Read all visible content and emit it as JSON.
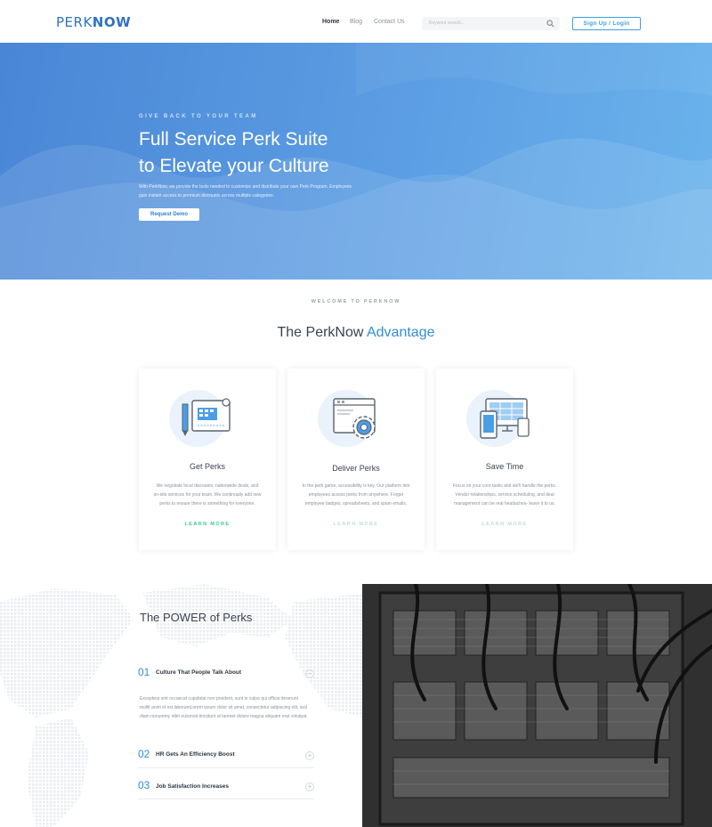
{
  "header": {
    "logo_light": "PERK",
    "logo_bold": "NOW",
    "nav": [
      "Home",
      "Blog",
      "Contact Us"
    ],
    "search_placeholder": "Keyword search...",
    "signup_label": "Sign Up / Login"
  },
  "hero": {
    "eyebrow": "GIVE BACK TO YOUR TEAM",
    "title_line1": "Full Service Perk Suite",
    "title_line2": "to Elevate your Culture",
    "description": "With PerkNow, we provide the tools needed to customize and distribute your own Perk Program. Employees gain instant access to premium discounts across multiple categories.",
    "button_label": "Request Demo"
  },
  "advantage": {
    "eyebrow": "WELCOME TO PERKNOW",
    "title_plain": "The PerkNow",
    "title_accent": "Advantage",
    "cards": [
      {
        "icon": "blueprint-icon",
        "title": "Get Perks",
        "text": "We negotiate local discounts, nationwide deals, and on-site services for your team. We continually add new perks to ensure there is something for everyone.",
        "link": "LEARN MORE",
        "link_color": "#3ec78f"
      },
      {
        "icon": "gear-window-icon",
        "title": "Deliver Perks",
        "text": "In the perk game, accessibility is key. Our platform lets employees access perks from anywhere. Forget employee badges, spreadsheets, and spam emails.",
        "link": "LEARN MORE",
        "link_color": "#b9e3d1"
      },
      {
        "icon": "devices-icon",
        "title": "Save Time",
        "text": "Focus on your core tasks and we'll handle the perks. Vendor relationships, service scheduling, and deal management can be real headaches- leave it to us.",
        "link": "LEARN MORE",
        "link_color": "#b9e3d1"
      }
    ]
  },
  "power": {
    "title": "The POWER of Perks",
    "items": [
      {
        "number": "01",
        "label": "Culture That People Talk About",
        "toggle": "−",
        "body": "Excepteur sint occaecat cupidatat non proident, sunt in culpa qui officia deserunt mollit anim id est laborumLorem ipsum dolor sit amet, consectetur adipiscing elit, sed diam nonummy nibh euismod tincidunt ut laoreet dolore magna aliquam erat volutpat."
      },
      {
        "number": "02",
        "label": "HR Gets An Efficiency Boost",
        "toggle": "+"
      },
      {
        "number": "03",
        "label": "Job Satisfaction Increases",
        "toggle": "+"
      }
    ]
  }
}
